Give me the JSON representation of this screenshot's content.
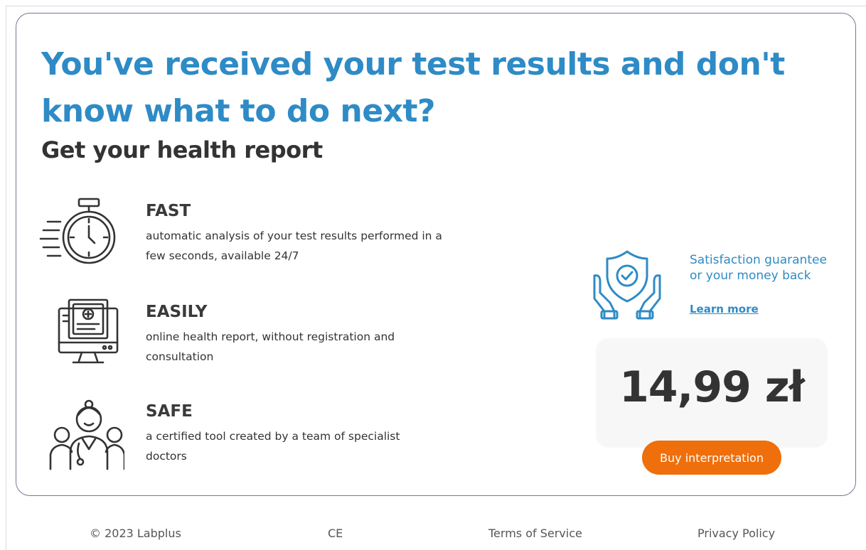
{
  "hero": {
    "headline": "You've received your test results and don't know what to do next?",
    "subhead": "Get your health report"
  },
  "features": [
    {
      "icon": "stopwatch-icon",
      "title": "FAST",
      "description": "automatic analysis of your test results performed in a few seconds, available 24/7"
    },
    {
      "icon": "computer-report-icon",
      "title": "EASILY",
      "description": "online health report, without registration and consultation"
    },
    {
      "icon": "doctors-team-icon",
      "title": "SAFE",
      "description": "a certified tool created by a team of specialist doctors"
    }
  ],
  "guarantee": {
    "icon": "shield-hands-icon",
    "text": "Satisfaction guarantee or your money back",
    "link": "Learn more"
  },
  "pricing": {
    "price": "14,99 zł",
    "button": "Buy interpretation"
  },
  "footer": {
    "copyright": "© 2023 Labplus",
    "ce": "CE",
    "terms": "Terms of Service",
    "privacy": "Privacy Policy"
  },
  "colors": {
    "accent": "#2e8bc6",
    "button": "#ee6f0c",
    "border": "#7a7497"
  }
}
